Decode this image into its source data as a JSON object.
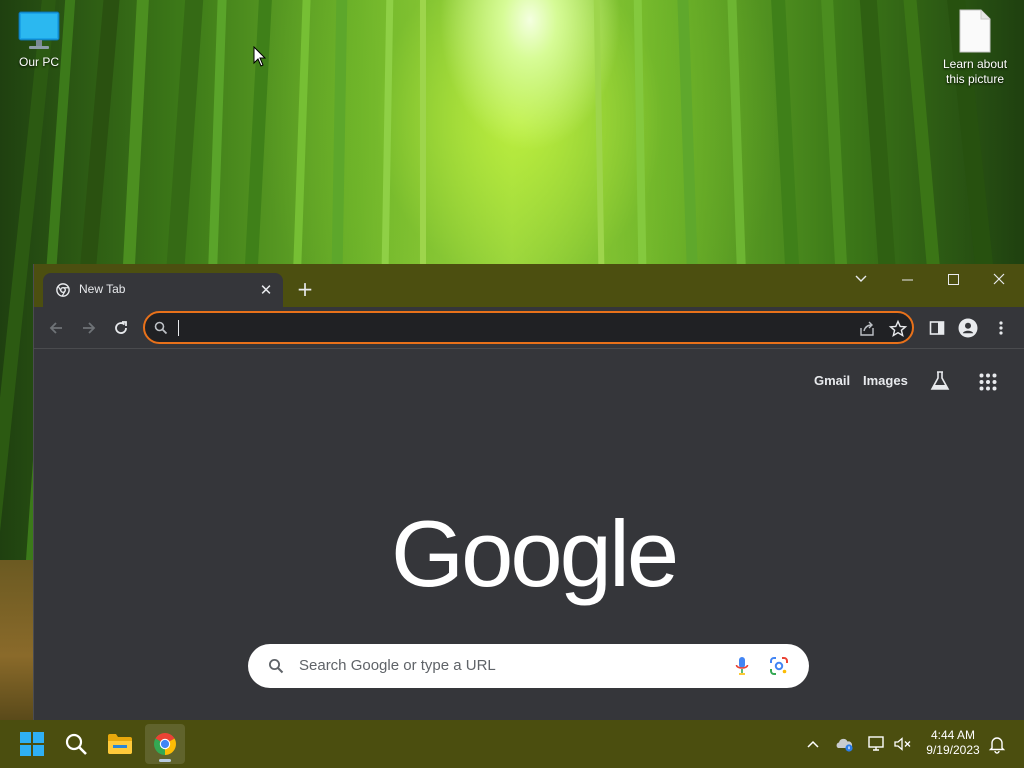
{
  "desktop": {
    "icons": [
      {
        "label": "Our PC"
      },
      {
        "label": "Learn about this picture"
      }
    ]
  },
  "browser": {
    "tab": {
      "title": "New Tab"
    },
    "omnibox": {
      "value": ""
    },
    "ntp": {
      "links": {
        "gmail": "Gmail",
        "images": "Images"
      },
      "logo": "Google",
      "search_placeholder": "Search Google or type a URL"
    }
  },
  "taskbar": {
    "clock": {
      "time": "4:44 AM",
      "date": "9/19/2023"
    }
  },
  "colors": {
    "omnibox_focus_ring": "#e8711a",
    "titlebar": "#4c4f10",
    "taskbar": "#4b4e0f",
    "ntp_background": "#35363a"
  }
}
